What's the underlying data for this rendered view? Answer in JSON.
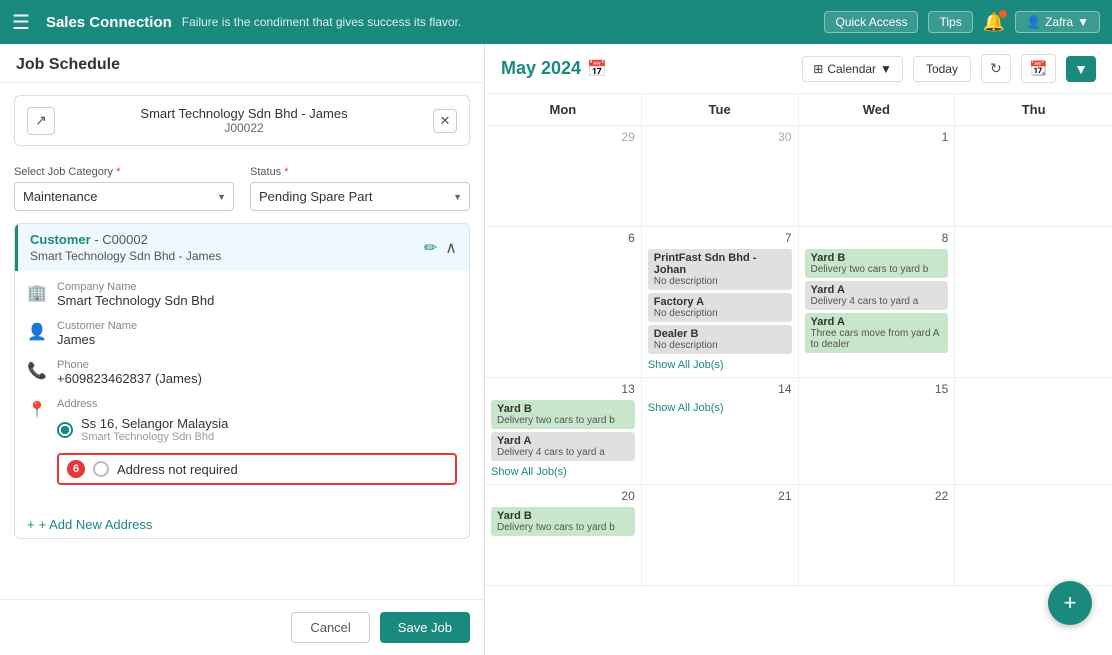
{
  "topnav": {
    "menu_icon": "☰",
    "brand": "Sales Connection",
    "tagline": "Failure is the condiment that gives success its flavor.",
    "quick_access": "Quick Access",
    "tips": "Tips",
    "user": "Zafra"
  },
  "left_panel": {
    "title": "Job Schedule",
    "company_card": {
      "name": "Smart Technology Sdn Bhd - James",
      "job_id": "J00022"
    },
    "job_category_label": "Select Job Category",
    "job_category_value": "Maintenance",
    "status_label": "Status",
    "status_value": "Pending Spare Part",
    "customer": {
      "label": "Customer",
      "code": "C00002",
      "name": "Smart Technology Sdn Bhd - James"
    },
    "company_name_label": "Company Name",
    "company_name_value": "Smart Technology Sdn Bhd",
    "customer_name_label": "Customer Name",
    "customer_name_value": "James",
    "phone_label": "Phone",
    "phone_value": "+609823462837 (James)",
    "address_label": "Address",
    "address_value": "Ss 16, Selangor Malaysia",
    "address_sub": "Smart Technology Sdn Bhd",
    "address_not_required": "Address not required",
    "badge_6": "6",
    "add_address": "+ Add New Address",
    "cancel": "Cancel",
    "save_job": "Save Job"
  },
  "calendar": {
    "title": "May 2024",
    "view": "Calendar",
    "today": "Today",
    "days_header": [
      "Mon",
      "Tue",
      "Wed",
      "Thu"
    ],
    "weeks": [
      {
        "cells": [
          {
            "date": "29",
            "in_month": false,
            "events": []
          },
          {
            "date": "30",
            "in_month": false,
            "events": []
          },
          {
            "date": "1",
            "in_month": true,
            "events": []
          },
          {
            "date": "",
            "in_month": false,
            "events": []
          }
        ]
      },
      {
        "cells": [
          {
            "date": "6",
            "in_month": true,
            "events": []
          },
          {
            "date": "7",
            "in_month": true,
            "events": [
              {
                "type": "gray",
                "title": "PrintFast Sdn Bhd - Johan",
                "desc": "No description"
              },
              {
                "type": "gray",
                "title": "Factory A",
                "desc": "No description"
              },
              {
                "type": "gray",
                "title": "Dealer B",
                "desc": "No description"
              },
              {
                "type": "show_all",
                "label": "Show All Job(s)"
              }
            ]
          },
          {
            "date": "8",
            "in_month": true,
            "events": [
              {
                "type": "green",
                "title": "Yard B",
                "desc": "Delivery two cars to yard b"
              },
              {
                "type": "gray",
                "title": "Yard A",
                "desc": "Delivery 4 cars to yard a"
              },
              {
                "type": "green",
                "title": "Yard A",
                "desc": "Three cars move from yard A to dealer"
              }
            ]
          },
          {
            "date": "",
            "in_month": false,
            "events": []
          }
        ]
      },
      {
        "cells": [
          {
            "date": "13",
            "in_month": true,
            "events": [
              {
                "type": "green",
                "title": "Yard B",
                "desc": "Delivery two cars to yard b"
              },
              {
                "type": "gray",
                "title": "Yard A",
                "desc": "Delivery 4 cars to yard a"
              },
              {
                "type": "show_all",
                "label": "Show All Job(s)"
              }
            ]
          },
          {
            "date": "14",
            "in_month": true,
            "events": [
              {
                "type": "show_all",
                "label": "Show All Job(s)"
              }
            ]
          },
          {
            "date": "15",
            "in_month": true,
            "events": []
          },
          {
            "date": "",
            "in_month": false,
            "events": []
          }
        ]
      },
      {
        "cells": [
          {
            "date": "20",
            "in_month": true,
            "events": [
              {
                "type": "green",
                "title": "Yard B",
                "desc": "Delivery two cars to yard b"
              }
            ]
          },
          {
            "date": "21",
            "in_month": true,
            "events": []
          },
          {
            "date": "22",
            "in_month": true,
            "events": []
          },
          {
            "date": "",
            "in_month": false,
            "events": []
          }
        ]
      }
    ]
  }
}
